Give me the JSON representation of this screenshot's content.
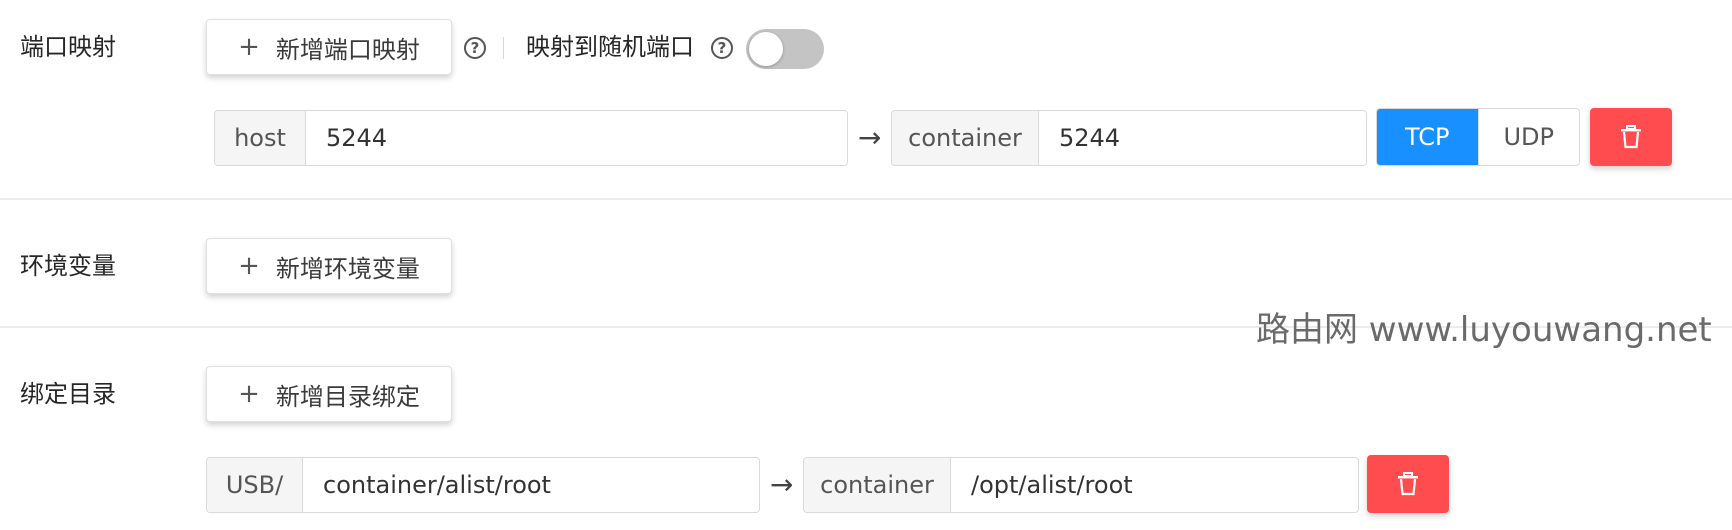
{
  "port_mapping": {
    "label": "端口映射",
    "add_button": "新增端口映射",
    "random_port_label": "映射到随机端口",
    "random_port_enabled": false,
    "mapping": {
      "host_addon": "host",
      "host_value": "5244",
      "container_addon": "container",
      "container_value": "5244",
      "protocols": [
        "TCP",
        "UDP"
      ],
      "selected_protocol": "TCP"
    }
  },
  "env_vars": {
    "label": "环境变量",
    "add_button": "新增环境变量"
  },
  "bind_dir": {
    "label": "绑定目录",
    "add_button": "新增目录绑定",
    "mapping": {
      "host_addon": "USB/",
      "host_value": "container/alist/root",
      "container_addon": "container",
      "container_value": "/opt/alist/root"
    }
  },
  "icons": {
    "plus": "plus-icon",
    "help": "question-circle-icon",
    "arrow": "arrow-right-icon",
    "delete": "trash-icon"
  },
  "colors": {
    "primary": "#1890ff",
    "danger": "#ff4d4f",
    "toggle_off": "#c4c4c4"
  },
  "watermark": "路由网 www.luyouwang.net"
}
